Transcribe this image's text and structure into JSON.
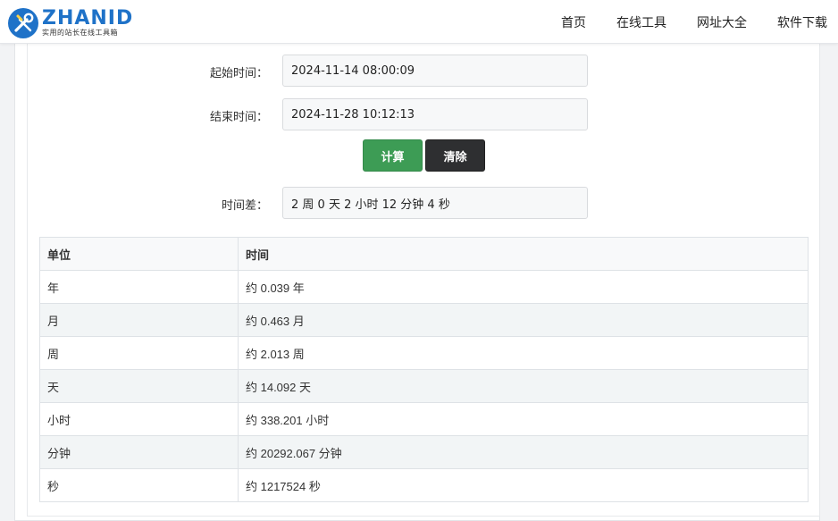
{
  "header": {
    "logo_word": "ZHANID",
    "logo_slogan": "实用的站长在线工具箱",
    "nav": [
      "首页",
      "在线工具",
      "网址大全",
      "软件下载"
    ]
  },
  "form": {
    "start_label": "起始时间：",
    "start_value": "2024-11-14 08:00:09",
    "end_label": "结束时间：",
    "end_value": "2024-11-28 10:12:13",
    "calc_label": "计算",
    "clear_label": "清除",
    "diff_label": "时间差：",
    "diff_value": "2 周 0 天 2 小时 12 分钟 4 秒"
  },
  "table": {
    "headers": [
      "单位",
      "时间"
    ],
    "rows": [
      {
        "unit": "年",
        "value": "约 0.039 年"
      },
      {
        "unit": "月",
        "value": "约 0.463 月"
      },
      {
        "unit": "周",
        "value": "约 2.013 周"
      },
      {
        "unit": "天",
        "value": "约 14.092 天"
      },
      {
        "unit": "小时",
        "value": "约 338.201 小时"
      },
      {
        "unit": "分钟",
        "value": "约 20292.067 分钟"
      },
      {
        "unit": "秒",
        "value": "约 1217524 秒"
      }
    ]
  },
  "colors": {
    "brand_blue": "#1f72c8",
    "calc_green": "#3d9c55",
    "clear_dark": "#2e2f31"
  }
}
